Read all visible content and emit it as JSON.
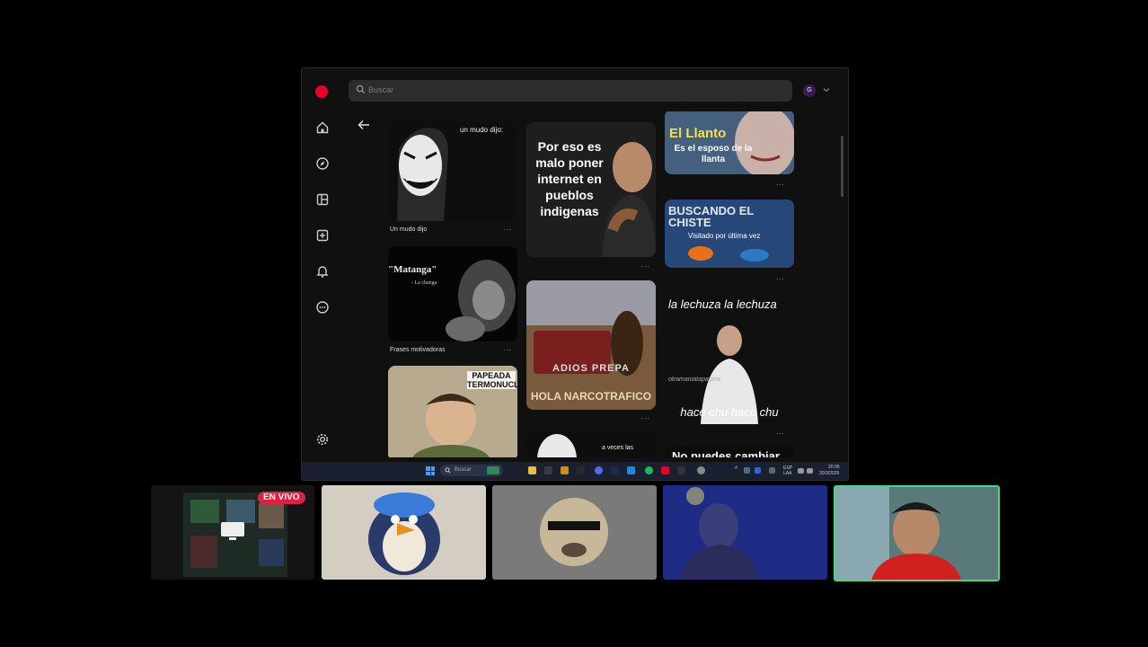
{
  "search": {
    "placeholder": "Buscar"
  },
  "profile": {
    "initial": "G"
  },
  "pins": [
    {
      "overlay": "un mudo dijo:",
      "title": "Un mudo dijo"
    },
    {
      "overlay": "\"Matanga\"",
      "sub": "- La changa",
      "title": "Frases motivadoras"
    },
    {
      "overlay": "PAPEADA TERMONUCLEAR"
    },
    {
      "overlay": "Por eso es malo poner internet en pueblos indigenas"
    },
    {
      "overlay_top": "ADIOS PREPA",
      "overlay_bottom": "HOLA NARCOTRAFICO"
    },
    {
      "overlay": "a veces las"
    },
    {
      "overlay": "El Llanto",
      "sub": "Es el esposo de la llanta"
    },
    {
      "overlay": "BUSCANDO EL CHISTE",
      "badge": "Visitado por última vez"
    },
    {
      "overlay_top": "la lechuza la lechuza",
      "overlay_bottom": "hace chu hace chu",
      "watermark": "otramaniatapagina"
    },
    {
      "overlay": "No puedes cambiar"
    }
  ],
  "more_label": "...",
  "taskbar": {
    "search_label": "Buscar",
    "lang": "ESP\nLAA",
    "time": "20:09",
    "date": "20/3/2026"
  },
  "stream": {
    "live_label": "EN VIVO"
  },
  "colors": {
    "pinterest_red": "#e6002a",
    "live_red": "#e02040",
    "speaking_border": "#3ddc84"
  }
}
